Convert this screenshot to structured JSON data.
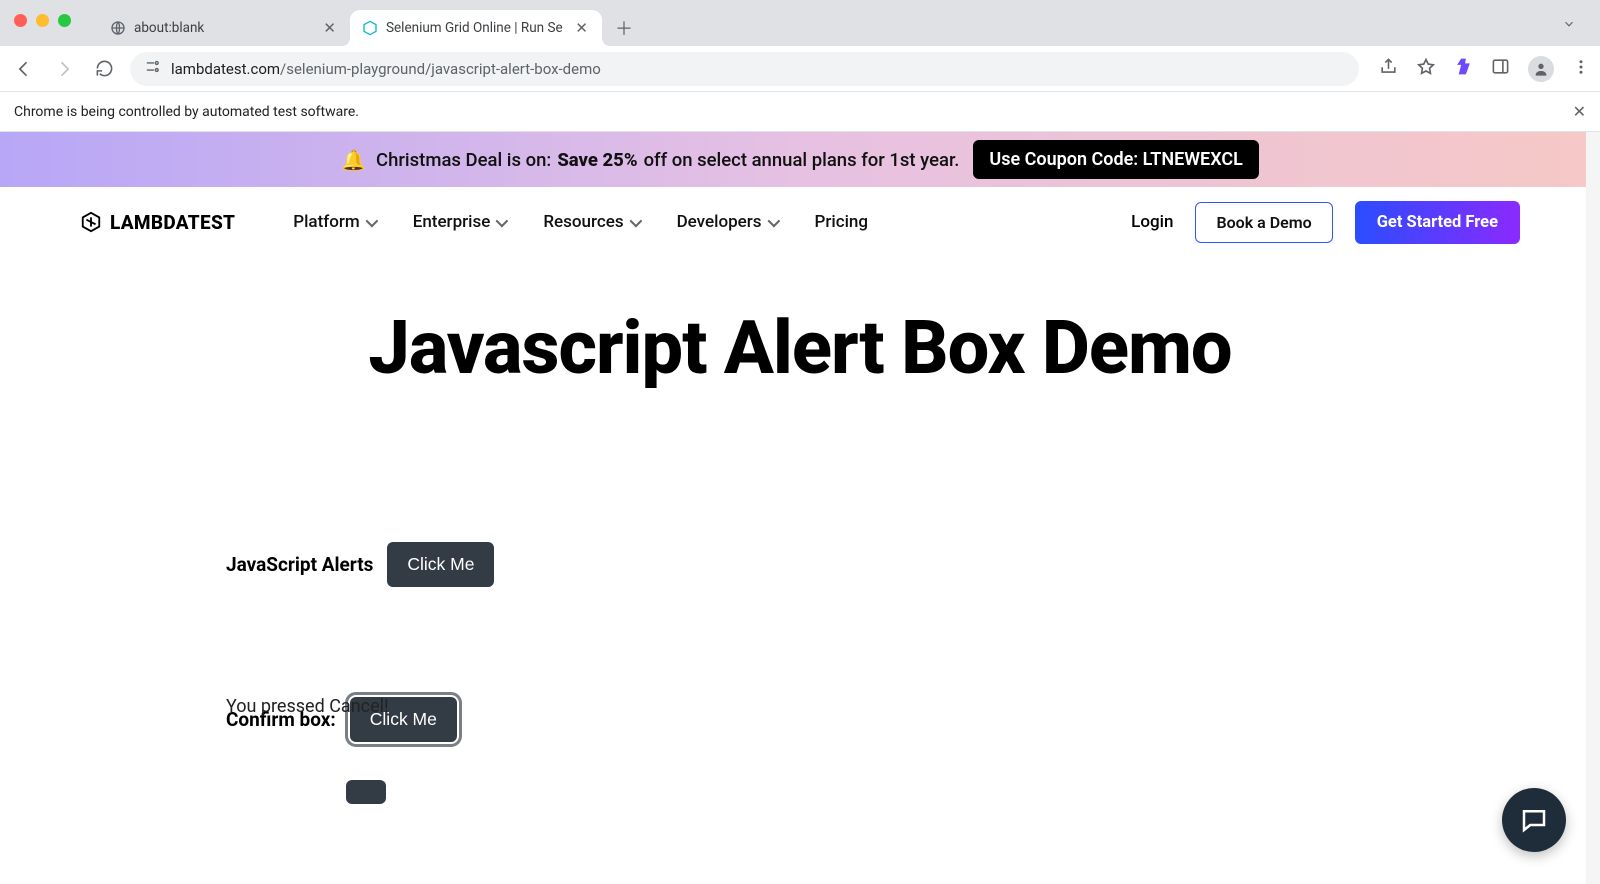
{
  "browser": {
    "tabs": [
      {
        "title": "about:blank",
        "active": false
      },
      {
        "title": "Selenium Grid Online | Run Se",
        "active": true
      }
    ],
    "url_host": "lambdatest.com",
    "url_path": "/selenium-playground/javascript-alert-box-demo",
    "infobar": "Chrome is being controlled by automated test software."
  },
  "promo": {
    "lead": "Christmas Deal is on:",
    "bold": "Save 25%",
    "tail": "off on select annual plans for 1st year.",
    "pill": "Use Coupon Code: LTNEWEXCL"
  },
  "brand": "LAMBDATEST",
  "nav": {
    "items": [
      "Platform",
      "Enterprise",
      "Resources",
      "Developers",
      "Pricing"
    ],
    "login": "Login",
    "demo": "Book a Demo",
    "cta": "Get Started Free"
  },
  "page": {
    "title": "Javascript Alert Box Demo",
    "rows": [
      {
        "label": "JavaScript Alerts",
        "button": "Click Me"
      },
      {
        "label": "Confirm box:",
        "button": "Click Me",
        "focused": true
      }
    ],
    "result": "You pressed Cancel!"
  }
}
